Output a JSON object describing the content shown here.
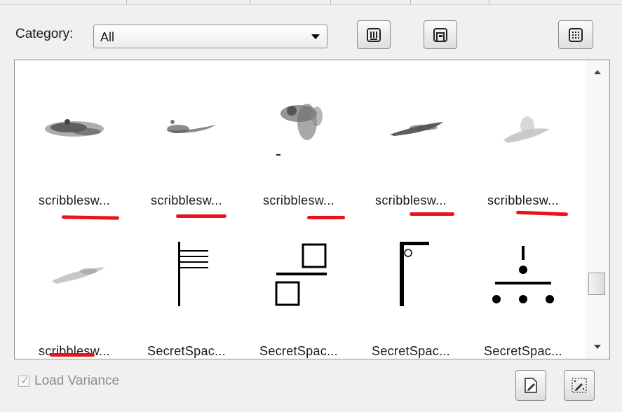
{
  "category": {
    "label": "Category:",
    "value": "All"
  },
  "toolbar": {
    "buttons": [
      "view-list-icon",
      "window-frame-icon",
      "grid-view-icon"
    ]
  },
  "tiles": [
    {
      "label": "scribblesw...",
      "thumb": "brush-scribble-1",
      "underlined": true
    },
    {
      "label": "scribblesw...",
      "thumb": "brush-scribble-2",
      "underlined": true
    },
    {
      "label": "scribblesw...",
      "thumb": "brush-scribble-3",
      "underlined": true
    },
    {
      "label": "scribblesw...",
      "thumb": "brush-scribble-4",
      "underlined": true
    },
    {
      "label": "scribblesw...",
      "thumb": "brush-scribble-5",
      "underlined": true
    },
    {
      "label": "scribblesw...",
      "thumb": "brush-scribble-6",
      "underlined": true
    },
    {
      "label": "SecretSpac...",
      "thumb": "flag-lines-symbol",
      "underlined": false
    },
    {
      "label": "SecretSpac...",
      "thumb": "offset-squares-symbol",
      "underlined": false
    },
    {
      "label": "SecretSpac...",
      "thumb": "gallows-symbol",
      "underlined": false
    },
    {
      "label": "SecretSpac...",
      "thumb": "dot-tree-symbol",
      "underlined": false
    }
  ],
  "load_variance": {
    "label": "Load Variance",
    "checked": true,
    "enabled": false
  },
  "bottom_buttons": [
    "edit-brush-icon",
    "brush-settings-icon"
  ],
  "colors": {
    "annotation_red": "#e8131b"
  }
}
